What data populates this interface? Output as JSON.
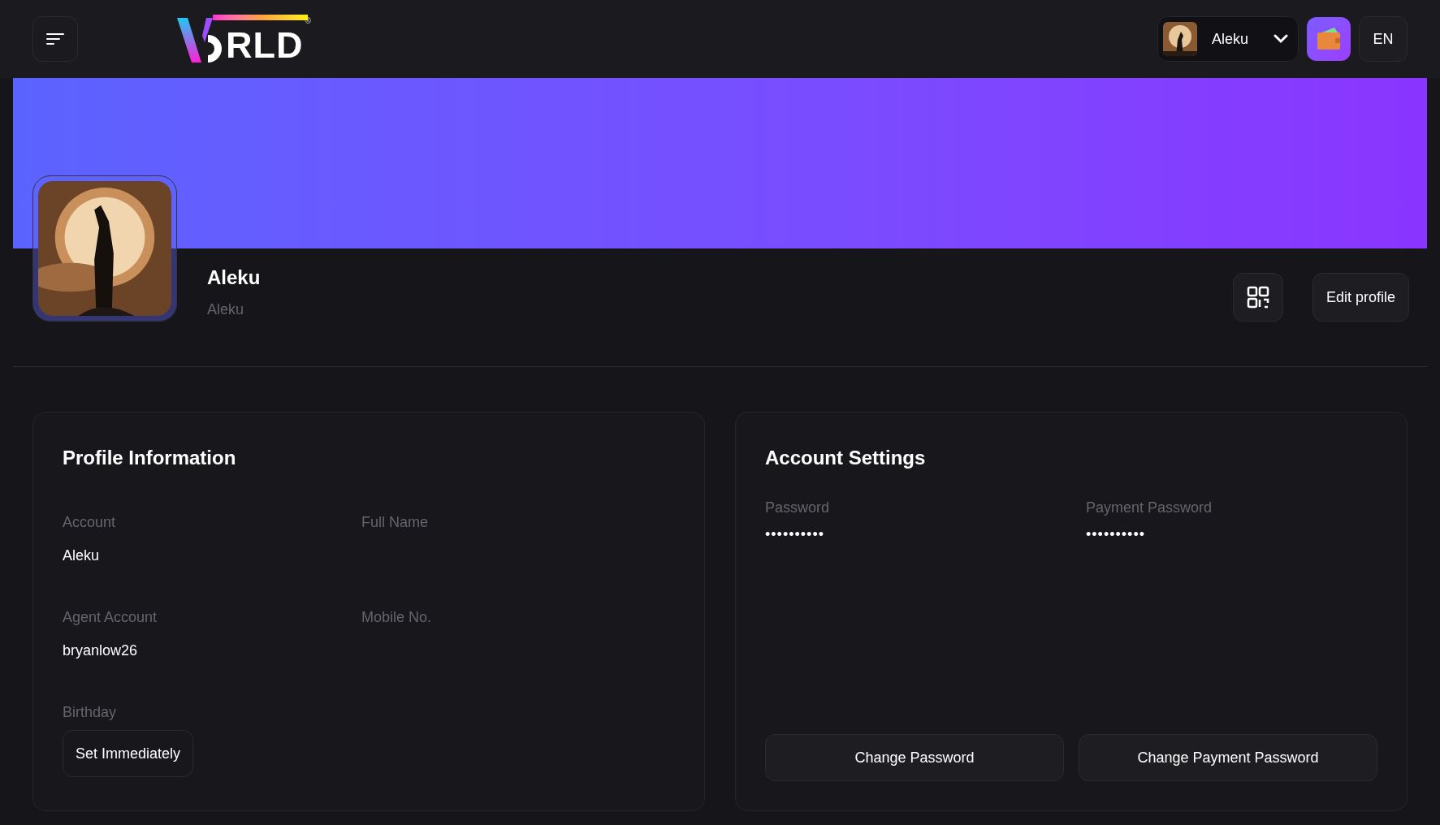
{
  "header": {
    "logo": {
      "text": "RLD",
      "mark": "®"
    },
    "user": {
      "name": "Aleku"
    },
    "language": "EN"
  },
  "profile": {
    "display_name": "Aleku",
    "username": "Aleku",
    "buttons": [
      "Edit profile"
    ]
  },
  "profile_information": {
    "title": "Profile Information",
    "fields": [
      {
        "label": "Account",
        "value": "Aleku"
      },
      {
        "label": "Full Name"
      },
      {
        "label": "Agent Account",
        "value": "bryanlow26"
      },
      {
        "label": "Mobile No."
      },
      {
        "label": "Birthday",
        "button": "Set Immediately"
      }
    ]
  },
  "account_settings": {
    "title": "Account Settings",
    "fields": [
      {
        "label": "Password",
        "value": "••••••••••"
      },
      {
        "label": "Payment Password",
        "value": "••••••••••"
      }
    ],
    "buttons": [
      "Change Password",
      "Change Payment Password"
    ]
  }
}
